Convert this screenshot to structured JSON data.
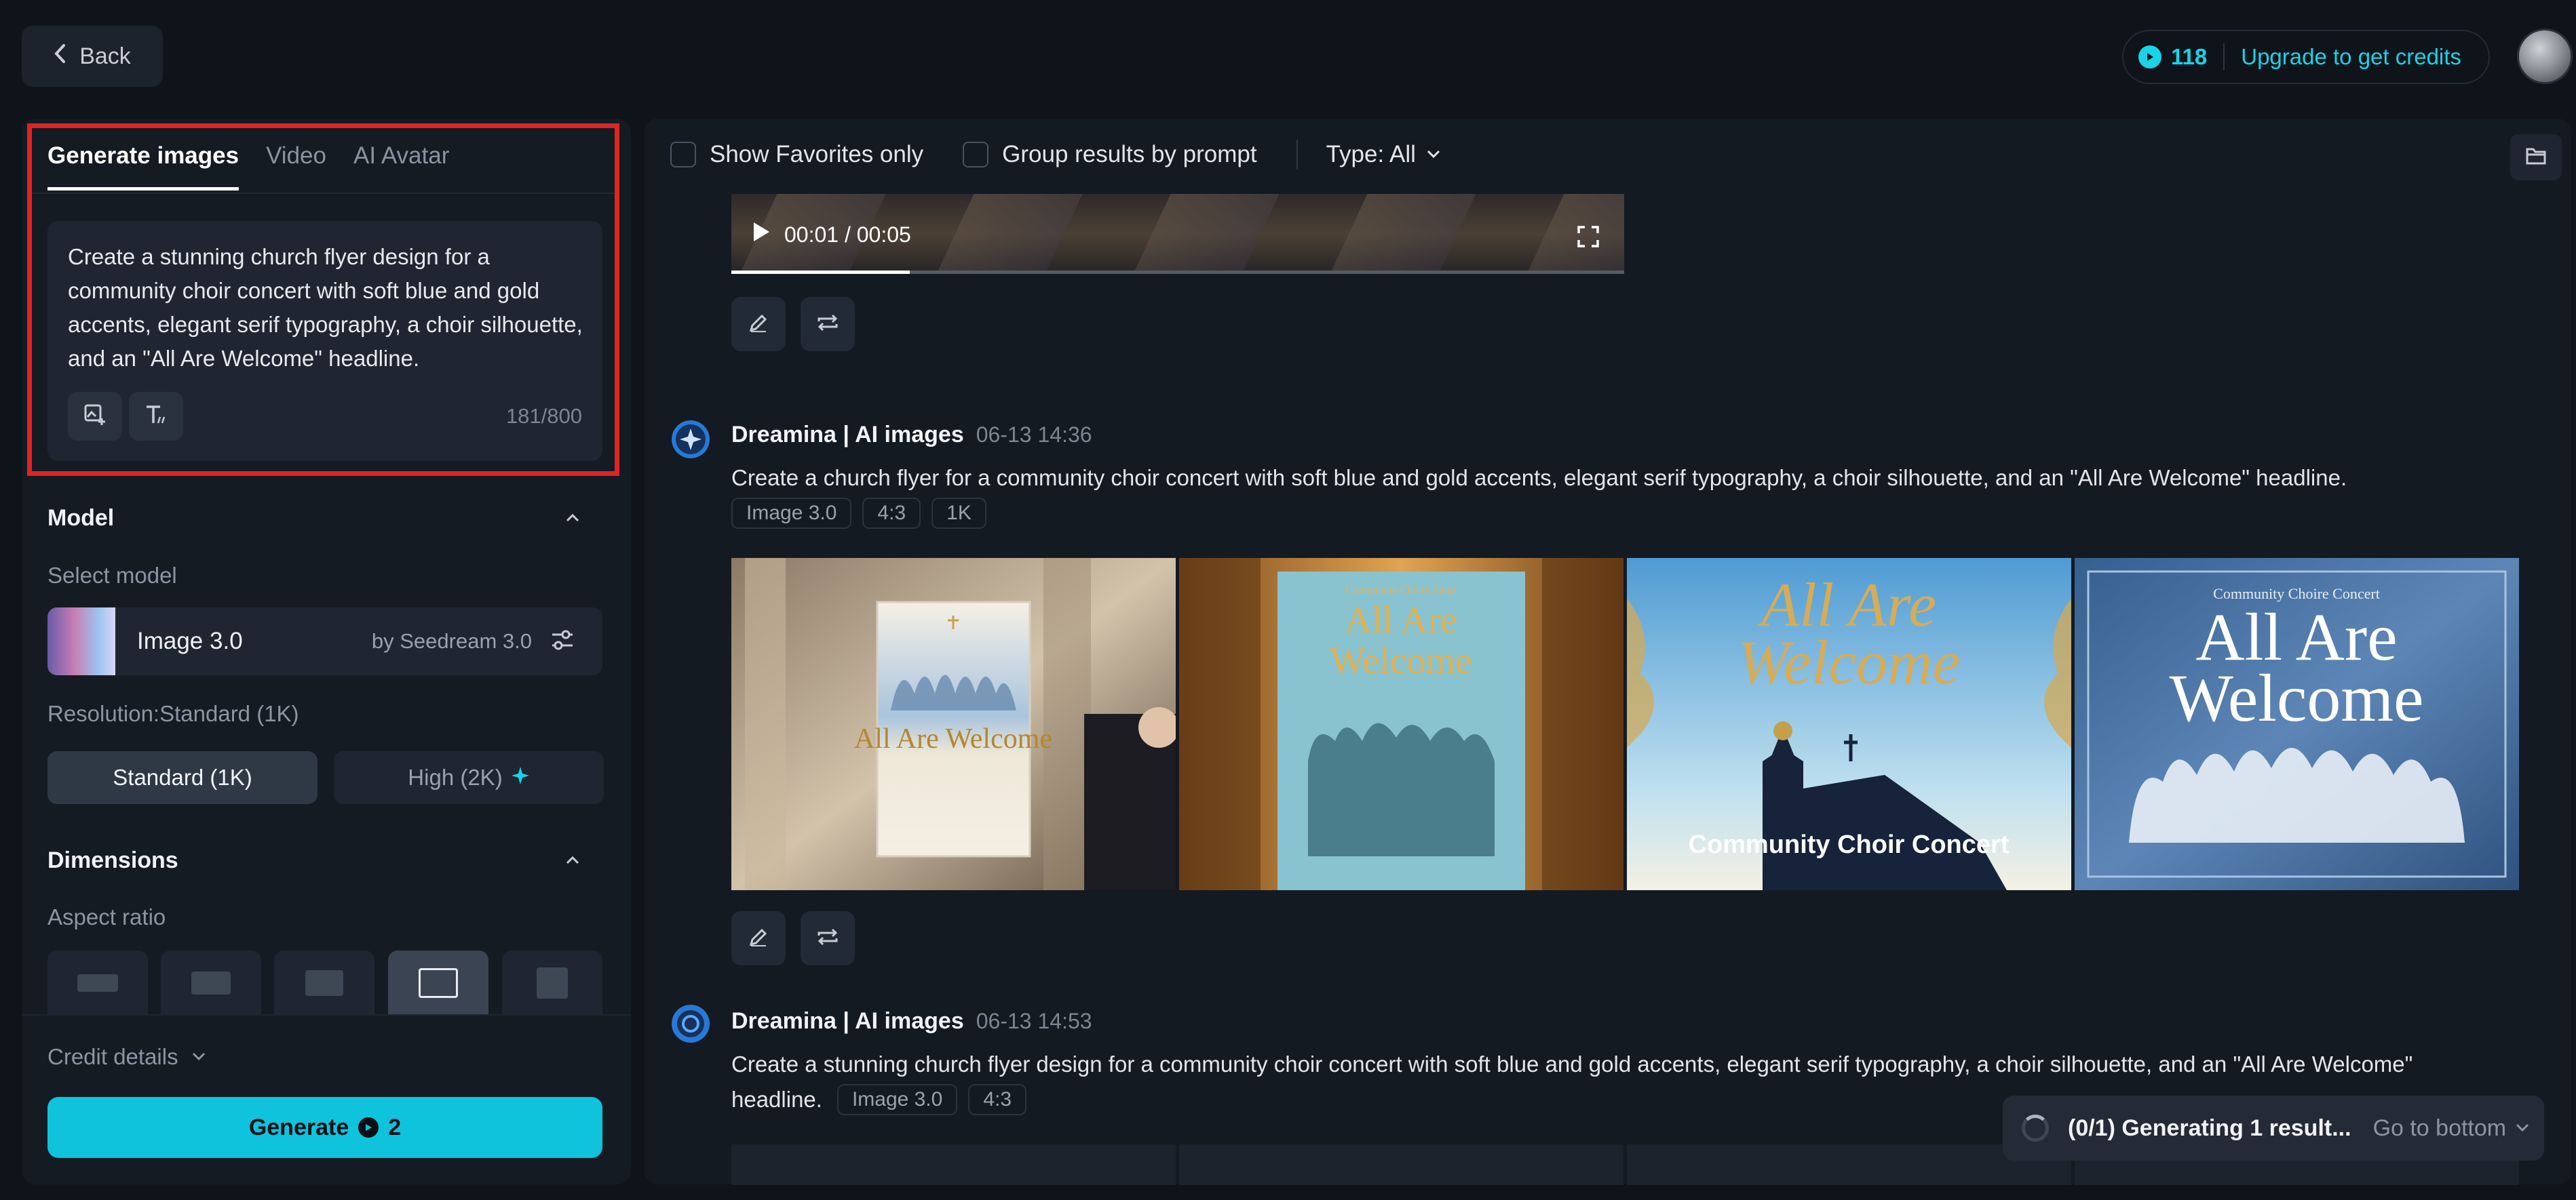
{
  "topbar": {
    "back_label": "Back",
    "credits": "118",
    "upgrade_label": "Upgrade to get credits"
  },
  "left": {
    "tabs": [
      "Generate images",
      "Video",
      "AI Avatar"
    ],
    "active_tab": "Generate images",
    "prompt": "Create a stunning church flyer design for a community choir concert with soft blue and gold accents, elegant serif typography, a choir silhouette, and an \"All Are Welcome\" headline.",
    "char_count": "181/800",
    "model_section": "Model",
    "select_model_label": "Select model",
    "model_name": "Image 3.0",
    "model_by": "by Seedream 3.0",
    "resolution_label": "Resolution:Standard (1K)",
    "res_standard": "Standard (1K)",
    "res_high": "High (2K)",
    "dimensions_section": "Dimensions",
    "aspect_label": "Aspect ratio",
    "credit_details": "Credit details",
    "generate_label": "Generate",
    "generate_cost": "2"
  },
  "filters": {
    "favorites": "Show Favorites only",
    "group": "Group results by prompt",
    "type": "Type: All"
  },
  "video": {
    "time": "00:01 / 00:05",
    "progress_fraction": 0.2
  },
  "results": [
    {
      "bot": "Dreamina | AI images",
      "time": "06-13  14:36",
      "prompt": "Create a church flyer for a community choir concert with soft blue and gold accents, elegant serif typography, a choir silhouette, and an \"All Are Welcome\" headline.",
      "chips": [
        "Image 3.0",
        "4:3",
        "1K"
      ]
    },
    {
      "bot": "Dreamina | AI images",
      "time": "06-13  14:53",
      "prompt_line1": "Create a stunning church flyer design for a community choir concert with soft blue and gold accents, elegant serif typography, a choir silhouette, and an \"All Are Welcome\"",
      "prompt_line2": "headline.",
      "chips": [
        "Image 3.0",
        "4:3"
      ]
    }
  ],
  "images": {
    "img1_title": "All Are Welcome",
    "img2_top": "Community Choire Sings",
    "img2_title_a": "All Are",
    "img2_title_b": "Welcome",
    "img3_title_a": "All Are",
    "img3_title_b": "Welcome",
    "img3_bottom": "Community Choir Concert",
    "img4_top": "Community Choire Concert",
    "img4_title_a": "All Are",
    "img4_title_b": "Welcome"
  },
  "status": {
    "generating": "(0/1) Generating 1 result...",
    "goto": "Go to bottom"
  },
  "colors": {
    "accent": "#19d3e6",
    "generate_bg": "#0fc3dc",
    "highlight_frame": "#e02424"
  }
}
